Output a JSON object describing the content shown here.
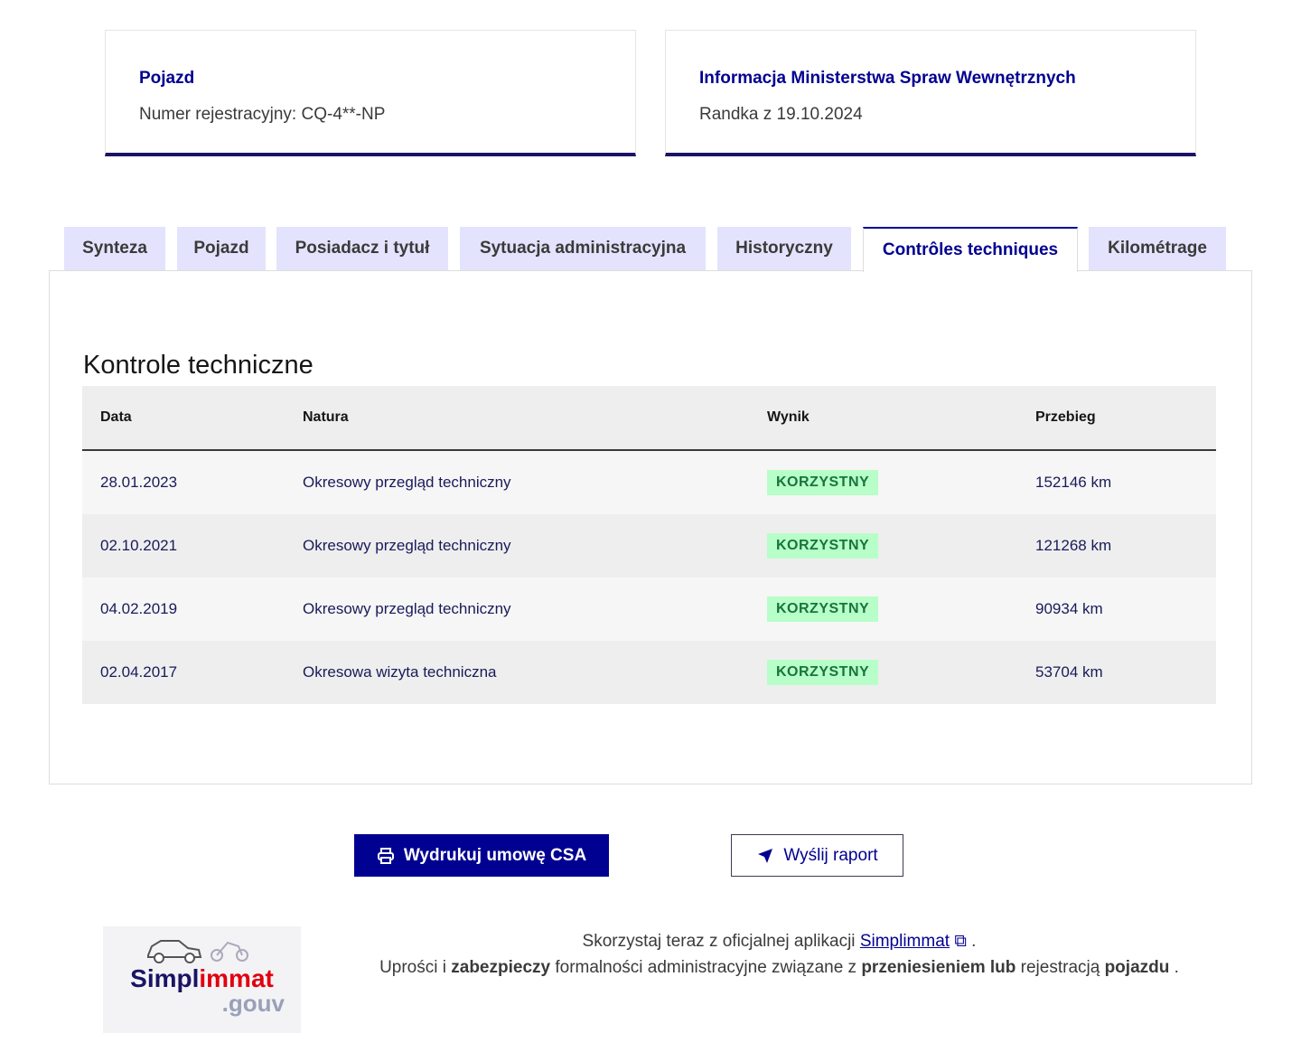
{
  "cards": [
    {
      "title": "Pojazd",
      "subtitle": "Numer rejestracyjny: CQ-4**-NP"
    },
    {
      "title": "Informacja Ministerstwa Spraw Wewnętrznych",
      "subtitle": "Randka z 19.10.2024"
    }
  ],
  "tabs": [
    "Synteza",
    "Pojazd",
    "Posiadacz i tytuł",
    "Sytuacja administracyjna",
    "Historyczny",
    "Contrôles techniques",
    "Kilométrage"
  ],
  "active_tab": "Contrôles techniques",
  "section_title": "Kontrole techniczne",
  "table": {
    "headers": [
      "Data",
      "Natura",
      "Wynik",
      "Przebieg"
    ],
    "rows": [
      [
        "28.01.2023",
        "Okresowy przegląd techniczny",
        "KORZYSTNY",
        "152146 km"
      ],
      [
        "02.10.2021",
        "Okresowy przegląd techniczny",
        "KORZYSTNY",
        "121268 km"
      ],
      [
        "04.02.2019",
        "Okresowy przegląd techniczny",
        "KORZYSTNY",
        "90934 km"
      ],
      [
        "02.04.2017",
        "Okresowa wizyta techniczna",
        "KORZYSTNY",
        "53704 km"
      ]
    ]
  },
  "buttons": {
    "print": "Wydrukuj umowę CSA",
    "send": "Wyślij raport"
  },
  "logo": {
    "simpl": "Simpl",
    "immat": "immat",
    "gouv": ".gouv"
  },
  "promo": {
    "line1_pre": "Skorzystaj teraz z oficjalnej aplikacji ",
    "link": "Simplimmat",
    "line1_post": " .",
    "p1": "Uprości i ",
    "b1": "zabezpieczy",
    "p2": " formalności administracyjne związane z ",
    "b2": "przeniesieniem lub",
    "p3": " rejestracją ",
    "b3": "pojazdu",
    "p4": " ."
  },
  "colors": {
    "primary": "#000091",
    "badge_bg": "#b8fec9",
    "badge_text": "#18753c"
  }
}
